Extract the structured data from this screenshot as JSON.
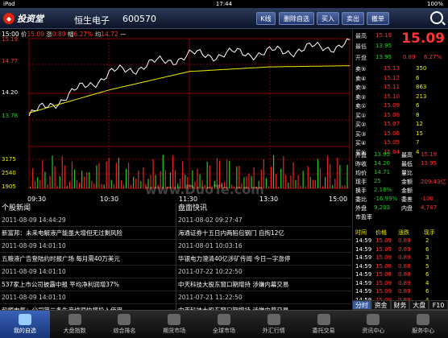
{
  "status": {
    "carrier": "iPad",
    "time": "17:44",
    "battery": "100%"
  },
  "header": {
    "logo": "投资堂",
    "name": "恒生电子",
    "code": "600570",
    "buttons": [
      "K线",
      "删除自选",
      "买入",
      "卖出",
      "撤单"
    ]
  },
  "quote_header": {
    "time": "15:00",
    "price_label": "价",
    "price": "15.09",
    "change_label": "涨",
    "change": "0.89",
    "pct_label": "幅",
    "pct": "6.27%",
    "avg_label": "均",
    "avg": "14.72",
    "dash": "—"
  },
  "chart_labels": {
    "prices": [
      "15.19",
      "14.77",
      "14.20",
      "13.78"
    ],
    "vols": [
      "3175",
      "2540",
      "1905"
    ],
    "times": [
      "09:30",
      "10:30",
      "11:30",
      "13:30",
      "15:00"
    ],
    "watermark": "www.DuoTe.com"
  },
  "chart_data": {
    "type": "line",
    "x": [
      "09:30",
      "10:30",
      "11:30",
      "13:30",
      "15:00"
    ],
    "ylim": [
      13.78,
      15.19
    ],
    "series": [
      {
        "name": "价",
        "values": [
          13.85,
          14.58,
          14.9,
          14.95,
          15.09
        ]
      },
      {
        "name": "均",
        "values": [
          13.9,
          14.3,
          14.62,
          14.7,
          14.72
        ]
      }
    ]
  },
  "right": {
    "high_label": "最高",
    "high": "15.19",
    "low_label": "最低",
    "low": "13.95",
    "big": "15.09",
    "open_label": "开盘",
    "open": "13.95",
    "open2": "0.89",
    "open3": "6.27%",
    "asks": [
      {
        "l": "卖⑤",
        "p": "15.13",
        "v": "350"
      },
      {
        "l": "卖④",
        "p": "15.12",
        "v": "6"
      },
      {
        "l": "卖③",
        "p": "15.11",
        "v": "863"
      },
      {
        "l": "卖②",
        "p": "15.10",
        "v": "213"
      },
      {
        "l": "卖①",
        "p": "15.09",
        "v": "6"
      }
    ],
    "bids": [
      {
        "l": "买①",
        "p": "15.08",
        "v": "8"
      },
      {
        "l": "买②",
        "p": "15.07",
        "v": "12"
      },
      {
        "l": "买③",
        "p": "15.06",
        "v": "15"
      },
      {
        "l": "买④",
        "p": "15.05",
        "v": "7"
      },
      {
        "l": "买⑤",
        "p": "15.04",
        "v": "4"
      }
    ],
    "stats": [
      [
        "开盘",
        "13.95",
        "最高",
        "15.19"
      ],
      [
        "昨收",
        "14.20",
        "最低",
        "13.95"
      ],
      [
        "均价",
        "14.71",
        "量比",
        ""
      ],
      [
        "现手",
        "25",
        "金额",
        "209.43亿"
      ],
      [
        "换手",
        "2.18%",
        "金额",
        ""
      ],
      [
        "委比",
        "-16.99%",
        "委差",
        "-100"
      ],
      [
        "外盘",
        "9,203",
        "内盘",
        "4,747"
      ],
      [
        "市盈率",
        "",
        "",
        ""
      ]
    ],
    "ticks_head": [
      "时间",
      "价格",
      "涨跌",
      "现手"
    ],
    "ticks": [
      [
        "14:59",
        "15.09",
        "0.89",
        "2"
      ],
      [
        "14:59",
        "15.09",
        "0.89",
        "6"
      ],
      [
        "14:59",
        "15.09",
        "0.89",
        "3"
      ],
      [
        "14:59",
        "15.08",
        "0.88",
        "5"
      ],
      [
        "14:59",
        "15.08",
        "0.88",
        "6"
      ],
      [
        "14:59",
        "15.09",
        "0.89",
        "4"
      ],
      [
        "14:59",
        "15.09",
        "0.89",
        "6"
      ],
      [
        "14:59",
        "15.09",
        "0.89",
        "4"
      ],
      [
        "14:59",
        "15.09",
        "0.89",
        "4"
      ]
    ]
  },
  "news": {
    "left_title": "个股新闻",
    "left": [
      [
        "d",
        "2011-08-09 14:44:29"
      ],
      [
        "t",
        "新富邦：未来电解液产能虽大增但无过剩风险"
      ],
      [
        "d",
        "2011-08-09 14:01:10"
      ],
      [
        "t",
        "五粮液广告登陆约时报广场 每月需40万美元"
      ],
      [
        "d",
        "2011-08-09 14:01:10"
      ],
      [
        "t",
        "537家上市公司披露中报 平均净利润增37%"
      ],
      [
        "d",
        "2011-08-09 14:01:10"
      ],
      [
        "t",
        "和顺电气：公司第二条生产线很快将投入使用"
      ]
    ],
    "right_title": "盘面快讯",
    "right": [
      [
        "d",
        "2011-08-02 09:27:47"
      ],
      [
        "t",
        "海通证券十五日内两陷包钢门 自掏12亿"
      ],
      [
        "d",
        "2011-08-01 10:03:16"
      ],
      [
        "t",
        "华银电力澄清40亿涉矿传闻 今日一字涨停"
      ],
      [
        "d",
        "2011-07-22 10:22:50"
      ],
      [
        "t",
        "中天科技大股东窗口期增持 涉嫌内幕交易"
      ],
      [
        "d",
        "2011-07-21 11:22:50"
      ],
      [
        "t",
        "中天科技大股东窗口期增持 涉嫌内幕交易"
      ]
    ]
  },
  "tabs": [
    "分时",
    "资金",
    "财务",
    "大盘",
    "F10"
  ],
  "bottom": [
    "我的自选",
    "大盘指数",
    "综合排名",
    "期货市场",
    "全球市场",
    "外汇行情",
    "委托交易",
    "资讯中心",
    "服务中心"
  ]
}
